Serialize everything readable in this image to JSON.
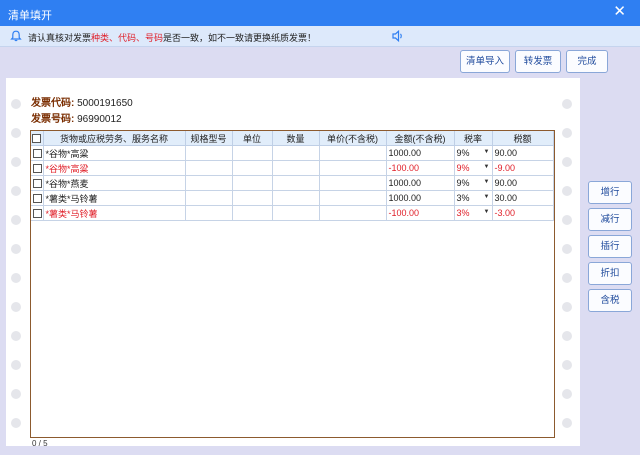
{
  "window": {
    "title": "清单填开",
    "close_glyph": "✕"
  },
  "notice": {
    "prefix": "请认真核对发票",
    "highlight": "种类、代码、号码",
    "suffix": "是否一致，如不一致请更换纸质发票！"
  },
  "toolbar": {
    "import_label": "清单导入",
    "convert_label": "转发票",
    "done_label": "完成"
  },
  "invoice": {
    "code_label": "发票代码:",
    "code_value": "5000191650",
    "number_label": "发票号码:",
    "number_value": "96990012"
  },
  "table": {
    "headers": [
      "货物或应税劳务、服务名称",
      "规格型号",
      "单位",
      "数量",
      "单价(不含税)",
      "金额(不含税)",
      "税率",
      "税额"
    ],
    "rows": [
      {
        "name": "*谷物*高粱",
        "amount": "1000.00",
        "rate": "9%",
        "tax": "90.00",
        "negative": false
      },
      {
        "name": "*谷物*高粱",
        "amount": "-100.00",
        "rate": "9%",
        "tax": "-9.00",
        "negative": true
      },
      {
        "name": "*谷物*燕麦",
        "amount": "1000.00",
        "rate": "9%",
        "tax": "90.00",
        "negative": false
      },
      {
        "name": "*薯类*马铃薯",
        "amount": "1000.00",
        "rate": "3%",
        "tax": "30.00",
        "negative": false
      },
      {
        "name": "*薯类*马铃薯",
        "amount": "-100.00",
        "rate": "3%",
        "tax": "-3.00",
        "negative": true
      }
    ]
  },
  "side_buttons": {
    "add_row": "增行",
    "del_row": "减行",
    "insert_row": "插行",
    "discount": "折扣",
    "tax_incl": "含税"
  },
  "footer": {
    "counter": "0 / 5"
  },
  "colors": {
    "titlebar": "#2f7ff2",
    "negative_text": "#e0202a",
    "grid_border": "#8c5a2e",
    "label_brown": "#7a2d00"
  }
}
